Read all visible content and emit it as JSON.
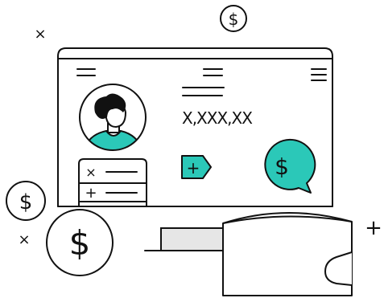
{
  "balance": {
    "amount": "X,XXX,XX"
  },
  "symbols": {
    "dollar": "$",
    "multiply": "×",
    "plus": "+"
  },
  "mini_list": {
    "items": [
      {
        "sign": "×"
      },
      {
        "sign": "+"
      }
    ]
  },
  "colors": {
    "accent": "#2bc8b8",
    "ink": "#111111",
    "panel_gray": "#e6e6e6",
    "background": "#ffffff"
  }
}
